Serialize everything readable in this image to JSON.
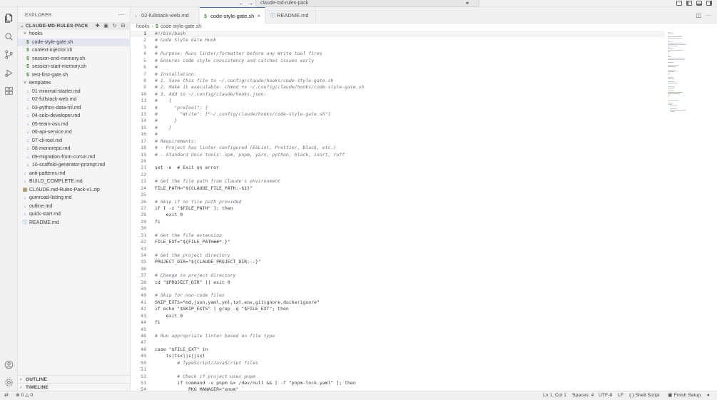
{
  "window": {
    "command_center": "claude-md-rules-pack"
  },
  "sidebar": {
    "title": "EXPLORER",
    "more": "···",
    "section": "CLAUDE-MD-RULES-PACK",
    "tree": [
      {
        "name": "hooks",
        "kind": "folder",
        "depth": 0,
        "open": true
      },
      {
        "name": "code-style-gate.sh",
        "kind": "sh",
        "depth": 1,
        "selected": true
      },
      {
        "name": "context-injector.sh",
        "kind": "sh",
        "depth": 1
      },
      {
        "name": "session-end-memory.sh",
        "kind": "sh",
        "depth": 1
      },
      {
        "name": "session-start-memory.sh",
        "kind": "sh",
        "depth": 1
      },
      {
        "name": "test-first-gate.sh",
        "kind": "sh",
        "depth": 1
      },
      {
        "name": "templates",
        "kind": "folder",
        "depth": 0,
        "open": true
      },
      {
        "name": "01-minimal-starter.md",
        "kind": "md",
        "depth": 1
      },
      {
        "name": "02-fullstack-web.md",
        "kind": "md",
        "depth": 1
      },
      {
        "name": "03-python-data-ml.md",
        "kind": "md",
        "depth": 1
      },
      {
        "name": "04-solo-developer.md",
        "kind": "md",
        "depth": 1
      },
      {
        "name": "05-team-oss.md",
        "kind": "md",
        "depth": 1
      },
      {
        "name": "06-api-service.md",
        "kind": "md",
        "depth": 1
      },
      {
        "name": "07-cli-tool.md",
        "kind": "md",
        "depth": 1
      },
      {
        "name": "08-monorepo.md",
        "kind": "md",
        "depth": 1
      },
      {
        "name": "09-migration-from-cursor.md",
        "kind": "md",
        "depth": 1
      },
      {
        "name": "10-scaffold-generator-prompt.md",
        "kind": "md",
        "depth": 1
      },
      {
        "name": "anti-patterns.md",
        "kind": "md",
        "depth": 0
      },
      {
        "name": "BUILD_COMPLETE.md",
        "kind": "md",
        "depth": 0
      },
      {
        "name": "CLAUDE.md-Rules-Pack-v1.zip",
        "kind": "zip",
        "depth": 0
      },
      {
        "name": "gumroad-listing.md",
        "kind": "md",
        "depth": 0
      },
      {
        "name": "outline.md",
        "kind": "md",
        "depth": 0
      },
      {
        "name": "quick-start.md",
        "kind": "md",
        "depth": 0
      },
      {
        "name": "README.md",
        "kind": "info",
        "depth": 0
      }
    ],
    "outline": "OUTLINE",
    "timeline": "TIMELINE"
  },
  "tabs": [
    {
      "label": "02-fullstack-web.md",
      "kind": "md",
      "active": false
    },
    {
      "label": "code-style-gate.sh",
      "kind": "sh",
      "active": true
    },
    {
      "label": "README.md",
      "kind": "info",
      "active": false
    }
  ],
  "breadcrumb": {
    "folder": "hooks",
    "file": "code-style-gate.sh"
  },
  "editor": {
    "lines": [
      "#!/bin/bash",
      "# Code Style Gate Hook",
      "#",
      "# Purpose: Runs linter/formatter before any Write tool fires",
      "# Ensures code style consistency and catches issues early",
      "#",
      "# Installation:",
      "# 1. Save this file to ~/.config/claude/hooks/code-style-gate.sh",
      "# 2. Make it executable: chmod +x ~/.config/claude/hooks/code-style-gate.sh",
      "# 3. Add to ~/.config/claude/hooks.json:",
      "#    {",
      "#      \"preTool\": {",
      "#        \"Write\": [\"~/.config/claude/hooks/code-style-gate.sh\"]",
      "#      }",
      "#    }",
      "#",
      "# Requirements:",
      "# - Project has linter configured (ESLint, Prettier, Black, etc.)",
      "# - Standard Unix tools: npm, pnpm, yarn, python, black, isort, ruff",
      "",
      "set -e  # Exit on error",
      "",
      "# Get the file path from Claude's environment",
      "FILE_PATH=\"${CLAUDE_FILE_PATH:-$1}\"",
      "",
      "# Skip if no file path provided",
      "if [ -z \"$FILE_PATH\" ]; then",
      "    exit 0",
      "fi",
      "",
      "# Get the file extension",
      "FILE_EXT=\"${FILE_PATH##*.}\"",
      "",
      "# Get the project directory",
      "PROJECT_DIR=\"${CLAUDE_PROJECT_DIR:-.}\"",
      "",
      "# Change to project directory",
      "cd \"$PROJECT_DIR\" || exit 0",
      "",
      "# Skip for non-code files",
      "SKIP_EXTS=\"md,json,yaml,yml,txt,env,gitignore,dockerignore\"",
      "if echo \"$SKIP_EXTS\" | grep -q \"$FILE_EXT\"; then",
      "    exit 0",
      "fi",
      "",
      "# Run appropriate linter based on file type",
      "",
      "case \"$FILE_EXT\" in",
      "    ts|tsx|js|jsx)",
      "        # TypeScript/JavaScript files",
      "",
      "        # Check if project uses pnpm",
      "        if command -v pnpm &> /dev/null && [ -f \"pnpm-lock.yaml\" ]; then",
      "            PKG_MANAGER=\"pnpm\""
    ]
  },
  "statusbar": {
    "errors": "0",
    "warnings": "0",
    "position": "Ln 1, Col 1",
    "spaces": "Spaces: 4",
    "encoding": "UTF-8",
    "eol": "LF",
    "language": "Shell Script",
    "finish_setup": "Finish Setup"
  }
}
